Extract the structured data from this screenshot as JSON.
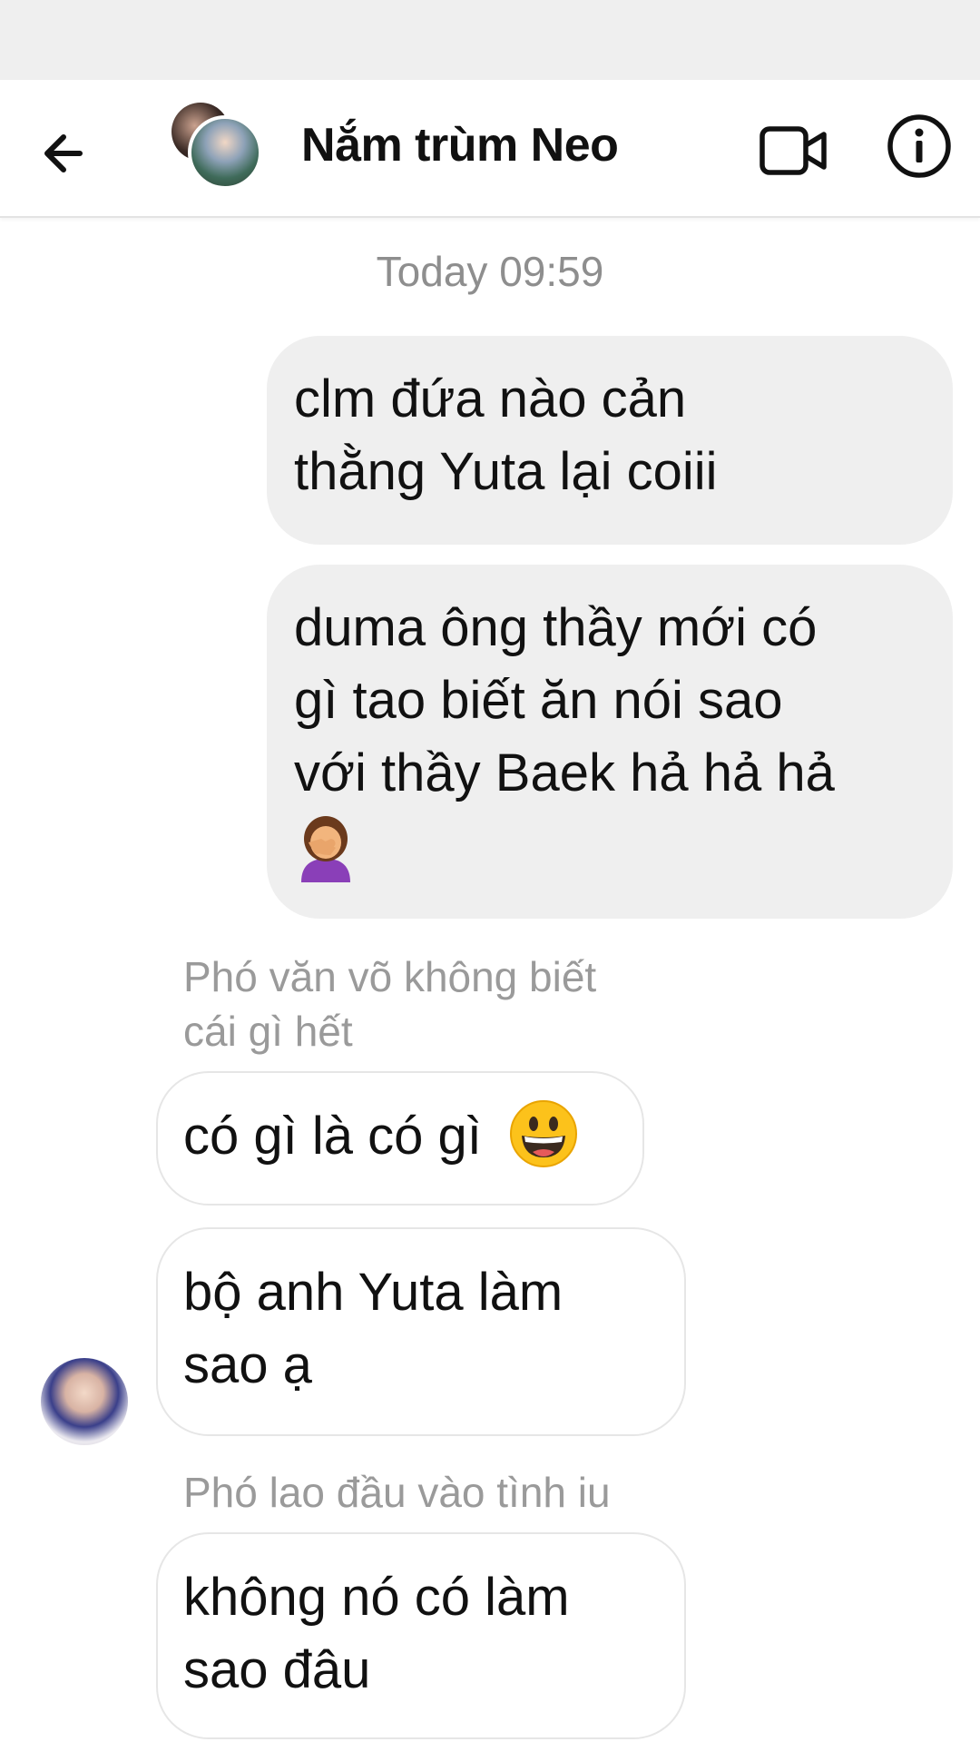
{
  "header": {
    "title": "Nắm trùm Neo"
  },
  "timestamp": "Today 09:59",
  "messages": {
    "out1": {
      "line1": "clm đứa nào cản",
      "line2": "thằng Yuta lại coiii"
    },
    "out2": {
      "line1": "duma ông thầy mới có",
      "line2": "gì tao biết ăn nói sao",
      "line3": "với thầy Baek hả hả hả",
      "emoji": "woman-facepalming-emoji"
    },
    "reply1": {
      "line1": "Phó văn võ không biết",
      "line2": "cái gì hết"
    },
    "in1": {
      "text": "có gì là có gì",
      "emoji": "grinning-face-emoji"
    },
    "in2": {
      "line1": "bộ anh Yuta làm",
      "line2": "sao ạ"
    },
    "reply2": {
      "text": "Phó lao đầu vào tình iu"
    },
    "in3": {
      "line1": "không nó có làm",
      "line2": "sao đâu"
    }
  },
  "colors": {
    "outgoing_bubble": "#efefef",
    "incoming_border": "#e6e6e6",
    "muted_text": "#8e8e8e"
  }
}
